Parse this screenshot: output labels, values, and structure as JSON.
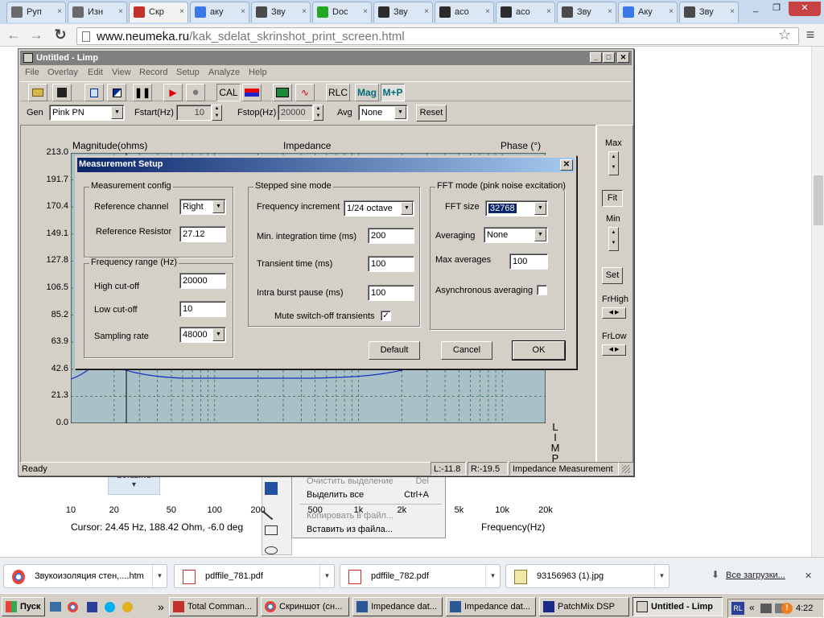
{
  "browser": {
    "tabs": [
      {
        "label": "Руп",
        "favicon_color": "#6a6a6a"
      },
      {
        "label": "Изн",
        "favicon_color": "#6a6a6a"
      },
      {
        "label": "Скр",
        "favicon_color": "#c4302b"
      },
      {
        "label": "аку",
        "favicon_color": "#3b78e7"
      },
      {
        "label": "Зву",
        "favicon_color": "#4a4a4a"
      },
      {
        "label": "Doc",
        "favicon_color": "#22a822"
      },
      {
        "label": "Зву",
        "favicon_color": "#2b2b2b"
      },
      {
        "label": "aco",
        "favicon_color": "#2b2b2b"
      },
      {
        "label": "aco",
        "favicon_color": "#2b2b2b"
      },
      {
        "label": "Зву",
        "favicon_color": "#4a4a4a"
      },
      {
        "label": "Аку",
        "favicon_color": "#3b78e7"
      },
      {
        "label": "Зву",
        "favicon_color": "#4a4a4a"
      }
    ],
    "tab_close_glyph": "×",
    "window_controls": {
      "minimize": "_",
      "maximize": "❐",
      "close": "✕"
    },
    "nav": {
      "back": "←",
      "forward": "→",
      "reload": "↻",
      "star": "☆",
      "menu": "≡"
    },
    "url": {
      "domain": "www.neumeka.ru",
      "path": "/kak_sdelat_skrinshot_print_screen.html"
    }
  },
  "limp": {
    "title": "Untitled - Limp",
    "title_buttons": {
      "minimize": "_",
      "maximize": "□",
      "close": "✕"
    },
    "menu": [
      "File",
      "Overlay",
      "Edit",
      "View",
      "Record",
      "Setup",
      "Analyze",
      "Help"
    ],
    "toolbar": {
      "cal": "CAL",
      "rlc": "RLC",
      "mag": "Mag",
      "mp": "M+P"
    },
    "gen": {
      "gen_label": "Gen",
      "gen_value": "Pink PN",
      "fstart_label": "Fstart(Hz)",
      "fstart_value": "10",
      "fstop_label": "Fstop(Hz)",
      "fstop_value": "20000",
      "avg_label": "Avg",
      "avg_value": "None",
      "reset_label": "Reset"
    },
    "plot": {
      "ylabel": "Magnitude(ohms)",
      "title": "Impedance",
      "phase_label": "Phase (°)",
      "y_ticks": [
        "213.0",
        "191.7",
        "170.4",
        "149.1",
        "127.8",
        "106.5",
        "85.2",
        "63.9",
        "42.6",
        "21.3",
        "0.0"
      ],
      "x_ticks": [
        "10",
        "20",
        "50",
        "100",
        "200",
        "500",
        "1k",
        "2k",
        "5k",
        "10k",
        "20k"
      ],
      "xlabel": "Frequency(Hz)",
      "watermark": [
        "L",
        "I",
        "M",
        "P"
      ],
      "cursor_text": "Cursor: 24.45 Hz, 188.42 Ohm, -6.0 deg"
    },
    "right_panel": {
      "max_label": "Max",
      "fit_label": "Fit",
      "min_label": "Min",
      "set_label": "Set",
      "frhigh_label": "FrHigh",
      "frlow_label": "FrLow"
    },
    "status": {
      "ready": "Ready",
      "l": "L:-11.8",
      "r": "R:-19.5",
      "mode": "Impedance Measurement"
    }
  },
  "dialog": {
    "title": "Measurement Setup",
    "close": "✕",
    "config": {
      "title": "Measurement config",
      "ref_channel_label": "Reference channel",
      "ref_channel_value": "Right",
      "ref_resistor_label": "Reference Resistor",
      "ref_resistor_value": "27.12"
    },
    "freq_range": {
      "title": "Frequency range (Hz)",
      "high_label": "High cut-off",
      "high_value": "20000",
      "low_label": "Low cut-off",
      "low_value": "10",
      "sampling_label": "Sampling rate",
      "sampling_value": "48000"
    },
    "stepped": {
      "title": "Stepped sine mode",
      "freq_inc_label": "Frequency increment",
      "freq_inc_value": "1/24 octave",
      "min_int_label": "Min. integration time (ms)",
      "min_int_value": "200",
      "transient_label": "Transient time (ms)",
      "transient_value": "100",
      "intra_label": "Intra burst pause (ms)",
      "intra_value": "100",
      "mute_label": "Mute switch-off transients",
      "mute_checked": "✓"
    },
    "fft": {
      "title": "FFT mode (pink noise excitation)",
      "size_label": "FFT size",
      "size_value": "32768",
      "averaging_label": "Averaging",
      "averaging_value": "None",
      "max_avg_label": "Max averages",
      "max_avg_value": "100",
      "async_label": "Asynchronous averaging"
    },
    "buttons": {
      "default": "Default",
      "cancel": "Cancel",
      "ok": "OK"
    }
  },
  "background_page": {
    "paste_label": "Вставить",
    "menu_items": [
      {
        "label": "Очистить выделение",
        "key": "Del",
        "enabled": false
      },
      {
        "label": "Выделить все",
        "key": "Ctrl+A",
        "enabled": true
      },
      {
        "label": "Копировать в файл...",
        "key": "",
        "enabled": false
      },
      {
        "label": "Вставить из файла...",
        "key": "",
        "enabled": true
      }
    ]
  },
  "downloads": {
    "items": [
      "Звукоизоляция стен,....htm",
      "pdffile_781.pdf",
      "pdffile_782.pdf",
      "93156963 (1).jpg"
    ],
    "all_label": "Все загрузки...",
    "close": "✕"
  },
  "taskbar": {
    "start": "Пуск",
    "chevron": "»",
    "buttons": [
      "Total Comman...",
      "Скриншот (сн...",
      "Impedance dat...",
      "Impedance dat...",
      "PatchMix DSP",
      "Untitled - Limp"
    ],
    "tray_lang": "RL",
    "clock": "4:22"
  }
}
